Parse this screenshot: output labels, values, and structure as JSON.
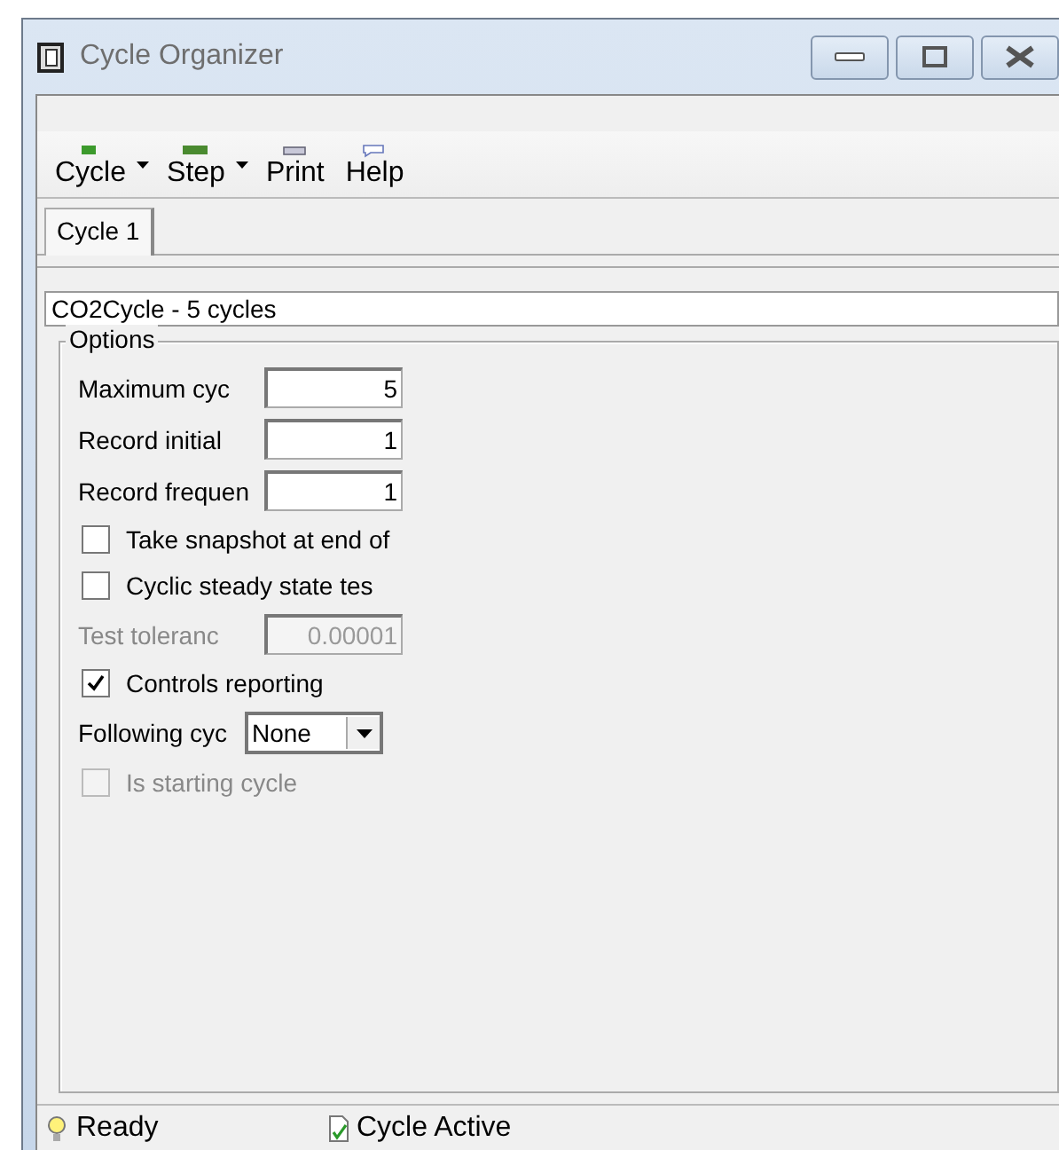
{
  "window": {
    "title": "Cycle Organizer"
  },
  "toolbar": [
    {
      "label": "Cycle",
      "dropdown": true
    },
    {
      "label": "Step",
      "dropdown": true
    },
    {
      "label": "Print"
    },
    {
      "label": "Help"
    }
  ],
  "tabs": [
    {
      "label": "Cycle 1",
      "selected": true
    }
  ],
  "name_field": {
    "value": "CO2Cycle - 5 cycles"
  },
  "options": {
    "title": "Options",
    "rows": [
      {
        "kind": "field",
        "label": "Maximum cyc",
        "value": "5",
        "disabled": false
      },
      {
        "kind": "field",
        "label": "Record initial",
        "value": "1",
        "disabled": false
      },
      {
        "kind": "field",
        "label": "Record frequen",
        "value": "1",
        "disabled": false
      },
      {
        "kind": "checkbox",
        "label": "Take snapshot at end of",
        "checked": false,
        "disabled": false
      },
      {
        "kind": "checkbox",
        "label": "Cyclic steady state tes",
        "checked": false,
        "disabled": false
      },
      {
        "kind": "field",
        "label": "Test toleranc",
        "value": "0.00001",
        "disabled": true
      },
      {
        "kind": "checkbox",
        "label": "Controls reporting",
        "checked": true,
        "disabled": false
      },
      {
        "kind": "select",
        "label": "Following cyc",
        "value": "None",
        "disabled": false
      },
      {
        "kind": "checkbox",
        "label": "Is starting cycle",
        "checked": false,
        "disabled": true
      }
    ]
  },
  "status_bar": [
    {
      "kind": "ready",
      "text": "Ready"
    },
    {
      "kind": "active",
      "text": "Cycle Active"
    }
  ]
}
